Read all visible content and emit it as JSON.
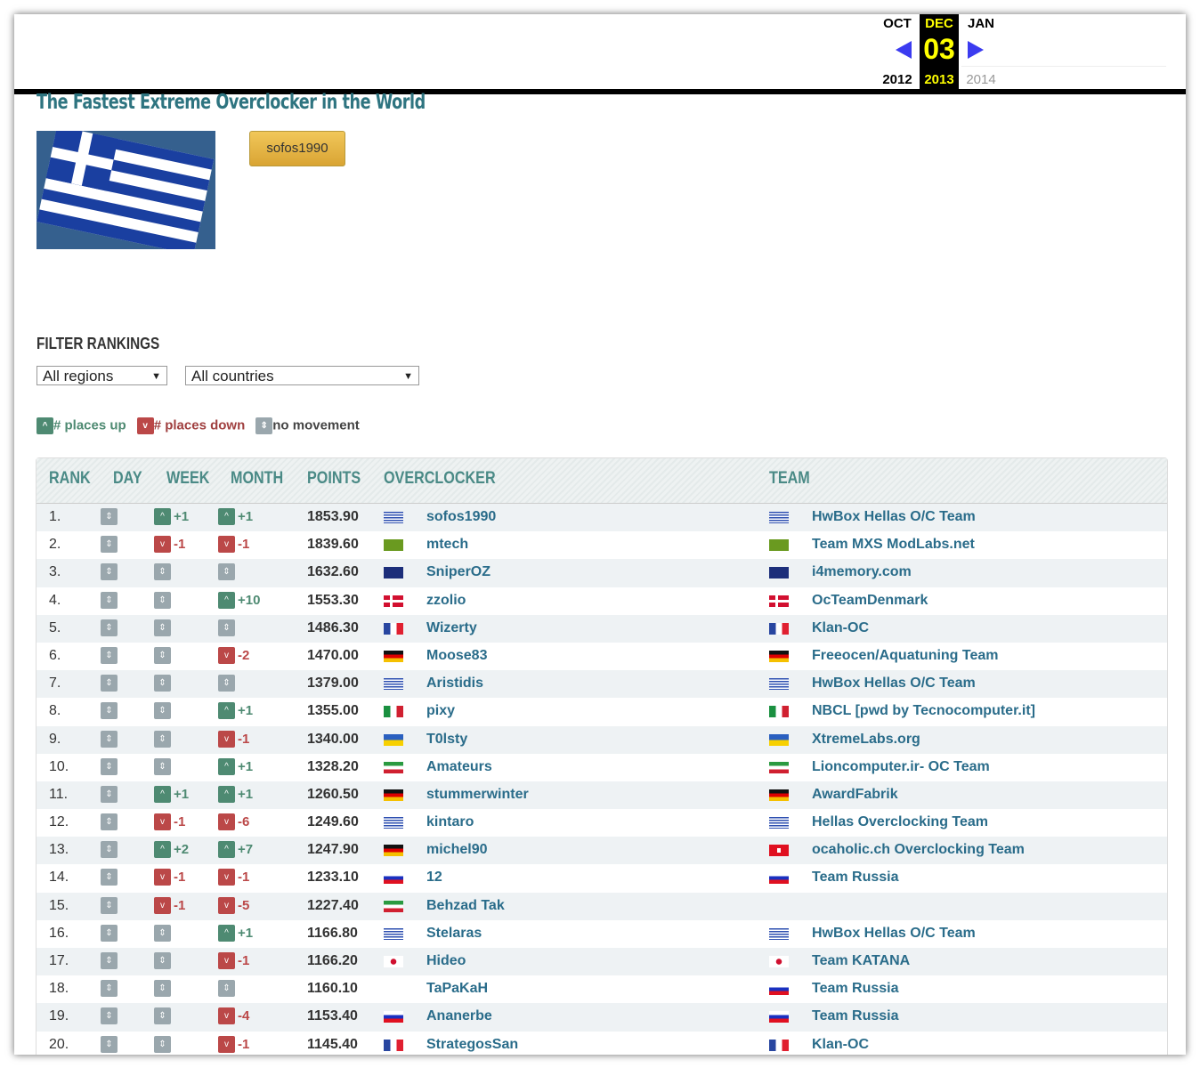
{
  "calendar": {
    "prev": {
      "month": "OCT",
      "year": "2012"
    },
    "current": {
      "month": "DEC",
      "day": "03",
      "year": "2013"
    },
    "next": {
      "month": "JAN",
      "year": "2014"
    }
  },
  "title": "The Fastest Extreme Overclocker in the World",
  "winner_badge": "sofos1990",
  "filter": {
    "heading": "FILTER RANKINGS",
    "region": "All regions",
    "country": "All countries"
  },
  "legend": {
    "up": "# places up",
    "down": "# places down",
    "none": "no movement"
  },
  "colors": {
    "up": "#4e8a72",
    "down": "#bb4848",
    "none": "#9aa7ad",
    "link": "#2a6c8a"
  },
  "columns": [
    "RANK",
    "DAY",
    "WEEK",
    "MONTH",
    "POINTS",
    "OVERCLOCKER",
    "TEAM"
  ],
  "rows": [
    {
      "rank": "1.",
      "day": "",
      "week": "+1",
      "month": "+1",
      "points": "1853.90",
      "flag": "gr",
      "name": "sofos1990",
      "tflag": "gr",
      "team": "HwBox Hellas O/C Team"
    },
    {
      "rank": "2.",
      "day": "",
      "week": "-1",
      "month": "-1",
      "points": "1839.60",
      "flag": "mx",
      "name": "mtech",
      "tflag": "mx",
      "team": "Team MXS ModLabs.net"
    },
    {
      "rank": "3.",
      "day": "",
      "week": "",
      "month": "",
      "points": "1632.60",
      "flag": "au",
      "name": "SniperOZ",
      "tflag": "au",
      "team": "i4memory.com"
    },
    {
      "rank": "4.",
      "day": "",
      "week": "",
      "month": "+10",
      "points": "1553.30",
      "flag": "dk",
      "name": "zzolio",
      "tflag": "dk",
      "team": "OcTeamDenmark"
    },
    {
      "rank": "5.",
      "day": "",
      "week": "",
      "month": "",
      "points": "1486.30",
      "flag": "fr",
      "name": "Wizerty",
      "tflag": "fr",
      "team": "Klan-OC"
    },
    {
      "rank": "6.",
      "day": "",
      "week": "",
      "month": "-2",
      "points": "1470.00",
      "flag": "de",
      "name": "Moose83",
      "tflag": "de",
      "team": "Freeocen/Aquatuning Team"
    },
    {
      "rank": "7.",
      "day": "",
      "week": "",
      "month": "",
      "points": "1379.00",
      "flag": "gr",
      "name": "Aristidis",
      "tflag": "gr",
      "team": "HwBox Hellas O/C Team"
    },
    {
      "rank": "8.",
      "day": "",
      "week": "",
      "month": "+1",
      "points": "1355.00",
      "flag": "it",
      "name": "pixy",
      "tflag": "it",
      "team": "NBCL [pwd by Tecnocomputer.it]"
    },
    {
      "rank": "9.",
      "day": "",
      "week": "",
      "month": "-1",
      "points": "1340.00",
      "flag": "ua",
      "name": "T0lsty",
      "tflag": "ua",
      "team": "XtremeLabs.org"
    },
    {
      "rank": "10.",
      "day": "",
      "week": "",
      "month": "+1",
      "points": "1328.20",
      "flag": "ir",
      "name": "Amateurs",
      "tflag": "ir",
      "team": "Lioncomputer.ir- OC Team"
    },
    {
      "rank": "11.",
      "day": "",
      "week": "+1",
      "month": "+1",
      "points": "1260.50",
      "flag": "de",
      "name": "stummerwinter",
      "tflag": "de",
      "team": "AwardFabrik"
    },
    {
      "rank": "12.",
      "day": "",
      "week": "-1",
      "month": "-6",
      "points": "1249.60",
      "flag": "gr",
      "name": "kintaro",
      "tflag": "gr",
      "team": "Hellas Overclocking Team"
    },
    {
      "rank": "13.",
      "day": "",
      "week": "+2",
      "month": "+7",
      "points": "1247.90",
      "flag": "de",
      "name": "michel90",
      "tflag": "ch",
      "team": "ocaholic.ch Overclocking Team"
    },
    {
      "rank": "14.",
      "day": "",
      "week": "-1",
      "month": "-1",
      "points": "1233.10",
      "flag": "ru",
      "name": "12",
      "tflag": "ru",
      "team": "Team Russia"
    },
    {
      "rank": "15.",
      "day": "",
      "week": "-1",
      "month": "-5",
      "points": "1227.40",
      "flag": "ir",
      "name": "Behzad Tak",
      "tflag": "",
      "team": ""
    },
    {
      "rank": "16.",
      "day": "",
      "week": "",
      "month": "+1",
      "points": "1166.80",
      "flag": "gr",
      "name": "Stelaras",
      "tflag": "gr",
      "team": "HwBox Hellas O/C Team"
    },
    {
      "rank": "17.",
      "day": "",
      "week": "",
      "month": "-1",
      "points": "1166.20",
      "flag": "jp",
      "name": "Hideo",
      "tflag": "jp",
      "team": "Team KATANA"
    },
    {
      "rank": "18.",
      "day": "",
      "week": "",
      "month": "",
      "points": "1160.10",
      "flag": "",
      "name": "TaPaKaH",
      "tflag": "ru",
      "team": "Team Russia"
    },
    {
      "rank": "19.",
      "day": "",
      "week": "",
      "month": "-4",
      "points": "1153.40",
      "flag": "ru",
      "name": "Ananerbe",
      "tflag": "ru",
      "team": "Team Russia"
    },
    {
      "rank": "20.",
      "day": "",
      "week": "",
      "month": "-1",
      "points": "1145.40",
      "flag": "fr",
      "name": "StrategosSan",
      "tflag": "fr",
      "team": "Klan-OC"
    }
  ]
}
